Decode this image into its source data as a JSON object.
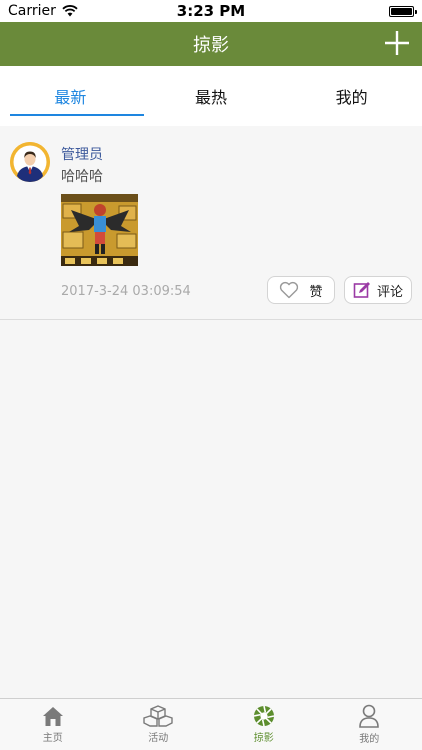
{
  "status_bar": {
    "carrier": "Carrier",
    "time": "3:23 PM"
  },
  "nav_bar": {
    "title": "掠影",
    "bg_color": "#6a8a3a"
  },
  "tabs": [
    {
      "label": "最新",
      "active": true
    },
    {
      "label": "最热",
      "active": false
    },
    {
      "label": "我的",
      "active": false
    }
  ],
  "accent_color": "#1e86e0",
  "post": {
    "author": "管理员",
    "content": "哈哈哈",
    "timestamp": "2017-3-24 03:09:54",
    "like_label": "赞",
    "comment_label": "评论"
  },
  "tab_bar": {
    "items": [
      {
        "label": "主页",
        "icon": "home-icon",
        "active": false
      },
      {
        "label": "活动",
        "icon": "boxes-icon",
        "active": false
      },
      {
        "label": "掠影",
        "icon": "aperture-icon",
        "active": true
      },
      {
        "label": "我的",
        "icon": "person-icon",
        "active": false
      }
    ],
    "active_color": "#5d8e2e"
  }
}
